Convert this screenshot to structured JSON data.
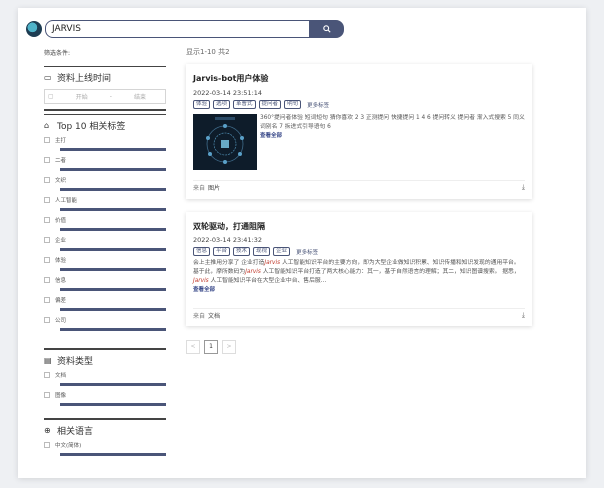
{
  "search": {
    "value": "JARVIS",
    "button_icon": "search-icon"
  },
  "filters": {
    "title": "筛选条件:",
    "date_section": {
      "title": "资料上线时间",
      "start_placeholder": "开始",
      "separator": "-",
      "end_placeholder": "结束"
    },
    "tags_section": {
      "title": "Top 10 相关标签",
      "items": [
        {
          "label": "主打",
          "level": 1.0
        },
        {
          "label": "二者",
          "level": 1.0
        },
        {
          "label": "文织",
          "level": 1.0
        },
        {
          "label": "人工智能",
          "level": 1.0
        },
        {
          "label": "价值",
          "level": 1.0
        },
        {
          "label": "企业",
          "level": 1.0
        },
        {
          "label": "体验",
          "level": 1.0
        },
        {
          "label": "信息",
          "level": 1.0
        },
        {
          "label": "偏差",
          "level": 1.0
        },
        {
          "label": "公司",
          "level": 1.0
        }
      ]
    },
    "type_section": {
      "title": "资料类型",
      "items": [
        {
          "label": "文档",
          "level": 1.0
        },
        {
          "label": "图像",
          "level": 1.0
        }
      ]
    },
    "lang_section": {
      "title": "相关语言",
      "items": [
        {
          "label": "中文(简体)",
          "level": 1.0
        }
      ]
    }
  },
  "results_summary": "显示1-10 共2",
  "results": [
    {
      "title": "Jarvis-bot用户体验",
      "date": "2022-03-14 23:51:14",
      "tags": [
        "体验",
        "选项",
        "革曹式",
        "提问者",
        "明句"
      ],
      "more_tags": "更多标签",
      "description": "360°提问者体验 短词短句 猜你喜欢 2 3 正测提问 快捷提问 1 4 6 提问转义 提问者 渐入式搜索 5 同义词别名 7 拆进式引导语句 6",
      "see_all": "查看全部",
      "source_label": "来自",
      "source_value": "图片"
    },
    {
      "title": "双轮驱动，打通阻隔",
      "date": "2022-03-14 23:41:32",
      "tags": [
        "信息",
        "平台",
        "技术",
        "现视",
        "企业"
      ],
      "more_tags": "更多标签",
      "desc_parts": [
        "会上主推用分享了 企业打造",
        "Jarvis",
        " 人工智能知识平台的主要方向，即为大型企业做知识积累、知识传播和知识发现的通用平台。 基于此，摩所数码为",
        "Jarvis",
        " 人工智能知识平台打造了两大核心能力：其一，基于自然语言的理解；其二，知识图谱搜索。 据悉，",
        "Jarvis",
        " 人工智能知识平台在大型企业中台、售后服..."
      ],
      "see_all": "查看全部",
      "source_label": "来自",
      "source_value": "文档"
    }
  ],
  "pagination": {
    "prev": "<",
    "current": "1",
    "next": ">"
  }
}
